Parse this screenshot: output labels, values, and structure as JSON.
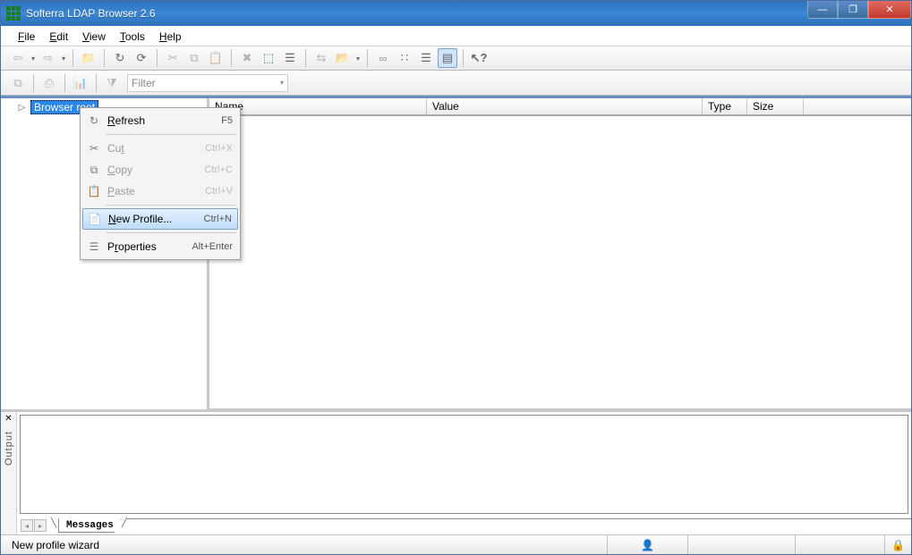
{
  "window": {
    "title": "Softerra LDAP Browser 2.6"
  },
  "menubar": [
    "File",
    "Edit",
    "View",
    "Tools",
    "Help"
  ],
  "toolbar1_icons": [
    "back-icon",
    "forward-icon",
    "sep",
    "up-folder-icon",
    "sep",
    "refresh-single-icon",
    "refresh-all-icon",
    "sep",
    "cut-icon",
    "copy-icon",
    "paste-icon",
    "sep",
    "delete-icon",
    "new-entry-icon",
    "properties-icon",
    "sep",
    "compare-icon",
    "find-folder-icon",
    "sep",
    "list-icon",
    "small-icons-icon",
    "details-icon",
    "columns-icon",
    "sep",
    "help-pointer-icon"
  ],
  "toolbar2": {
    "buttons": [
      "copy-result-icon",
      "print-icon",
      "chart-icon"
    ],
    "filter_label": "Filter"
  },
  "tree": {
    "root_label": "Browser root"
  },
  "columns": {
    "name": "Name",
    "value": "Value",
    "type": "Type",
    "size": "Size"
  },
  "context_menu": {
    "refresh": {
      "label": "Refresh",
      "shortcut": "F5"
    },
    "cut": {
      "label": "Cut",
      "shortcut": "Ctrl+X"
    },
    "copy": {
      "label": "Copy",
      "shortcut": "Ctrl+C"
    },
    "paste": {
      "label": "Paste",
      "shortcut": "Ctrl+V"
    },
    "new_profile": {
      "label": "New Profile...",
      "shortcut": "Ctrl+N"
    },
    "properties": {
      "label": "Properties",
      "shortcut": "Alt+Enter"
    }
  },
  "output": {
    "label": "Output",
    "tab": "Messages"
  },
  "status": {
    "text": "New profile wizard"
  }
}
